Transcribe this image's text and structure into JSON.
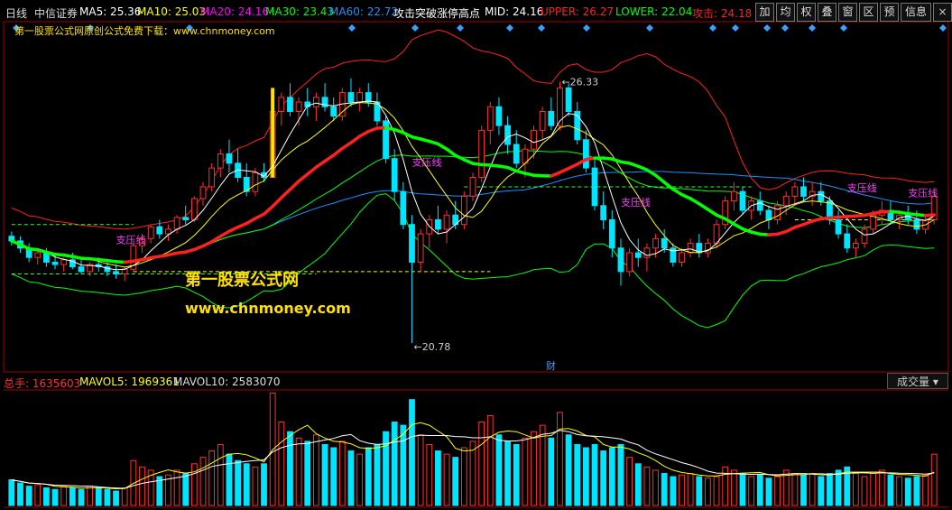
{
  "header": {
    "period": "日线",
    "stock": "中信证券",
    "indicators": [
      {
        "label": "MA5: 25.36",
        "color": "#ffffff"
      },
      {
        "label": "MA10: 25.03",
        "color": "#ffff00"
      },
      {
        "label": "MA20: 24.16",
        "color": "#ff00ff"
      },
      {
        "label": "MA30: 23.43",
        "color": "#00ff00"
      },
      {
        "label": "MA60: 22.72",
        "color": "#1e90ff"
      },
      {
        "label": "攻击突破涨停高点",
        "color": "#ffffff"
      },
      {
        "label": "MID: 24.16",
        "color": "#ffffff"
      },
      {
        "label": "UPPER: 26.27",
        "color": "#ff2020"
      },
      {
        "label": "LOWER: 22.04",
        "color": "#00ff00"
      },
      {
        "label": "攻击: 24.18",
        "color": "#ff2020"
      }
    ],
    "toolbar": [
      "加",
      "均",
      "权",
      "叠",
      "窗",
      "区",
      "预",
      "信息",
      "×"
    ]
  },
  "promo_text": "第一股票公式网原创公式免费下载：www.chnmoney.com",
  "watermark": {
    "title": "第一股票公式网",
    "url": "www.chnmoney.com"
  },
  "annotations": {
    "high": "←26.33",
    "low": "←20.78",
    "fin_mark": "财",
    "support": [
      "支压线",
      "支压线",
      "支压线",
      "支压线",
      "支压线",
      "支压线"
    ]
  },
  "volume_header": {
    "total": "总手: 1635603",
    "mavol5": "MAVOL5: 1969361",
    "mavol10": "MAVOL10: 2583070",
    "dropdown": "成交量"
  },
  "chart_data": {
    "type": "candlestick",
    "price_range": [
      20.4,
      27.3
    ],
    "marked_high": 26.33,
    "marked_low": 20.78,
    "series_colors": {
      "up": "#ff3030",
      "down": "#00e5ff",
      "MA5": "#ffffff",
      "MA10": "#ffff00",
      "MA30": "#00ff00",
      "MA60": "#1e90ff",
      "UPPER": "#ff2020",
      "LOWER": "#00ff00",
      "MID_bull": "#ff2020",
      "MID_bear": "#00ff00"
    },
    "ohlc": [
      [
        23.05,
        23.15,
        22.85,
        22.95
      ],
      [
        22.95,
        23.05,
        22.7,
        22.8
      ],
      [
        22.8,
        22.9,
        22.5,
        22.6
      ],
      [
        22.6,
        22.75,
        22.45,
        22.7
      ],
      [
        22.7,
        22.8,
        22.4,
        22.5
      ],
      [
        22.5,
        22.65,
        22.35,
        22.45
      ],
      [
        22.45,
        22.6,
        22.3,
        22.55
      ],
      [
        22.55,
        22.7,
        22.35,
        22.4
      ],
      [
        22.4,
        22.55,
        22.25,
        22.3
      ],
      [
        22.3,
        22.5,
        22.2,
        22.45
      ],
      [
        22.45,
        22.6,
        22.3,
        22.4
      ],
      [
        22.4,
        22.5,
        22.2,
        22.3
      ],
      [
        22.3,
        22.45,
        22.15,
        22.25
      ],
      [
        22.25,
        22.4,
        22.1,
        22.35
      ],
      [
        22.35,
        22.9,
        22.3,
        22.85
      ],
      [
        22.85,
        23.1,
        22.7,
        23.0
      ],
      [
        23.0,
        23.3,
        22.9,
        23.25
      ],
      [
        23.25,
        23.4,
        23.0,
        23.1
      ],
      [
        23.1,
        23.3,
        22.95,
        23.2
      ],
      [
        23.2,
        23.5,
        23.1,
        23.45
      ],
      [
        23.45,
        23.7,
        23.3,
        23.4
      ],
      [
        23.4,
        23.9,
        23.35,
        23.85
      ],
      [
        23.85,
        24.2,
        23.7,
        24.1
      ],
      [
        24.1,
        24.6,
        24.0,
        24.5
      ],
      [
        24.5,
        24.9,
        24.3,
        24.8
      ],
      [
        24.8,
        25.1,
        24.4,
        24.6
      ],
      [
        24.6,
        24.9,
        24.2,
        24.3
      ],
      [
        24.3,
        24.6,
        23.9,
        24.0
      ],
      [
        24.0,
        24.5,
        23.9,
        24.4
      ],
      [
        24.4,
        24.6,
        24.2,
        24.3
      ],
      [
        24.3,
        25.8,
        24.3,
        25.7
      ],
      [
        25.7,
        26.1,
        25.4,
        26.0
      ],
      [
        26.0,
        26.3,
        25.6,
        25.7
      ],
      [
        25.7,
        26.0,
        25.4,
        25.9
      ],
      [
        25.9,
        26.2,
        25.6,
        25.8
      ],
      [
        25.8,
        26.1,
        25.5,
        26.0
      ],
      [
        26.0,
        26.3,
        25.7,
        25.8
      ],
      [
        25.8,
        26.0,
        25.5,
        25.6
      ],
      [
        25.6,
        26.2,
        25.5,
        26.1
      ],
      [
        26.1,
        26.4,
        25.8,
        25.9
      ],
      [
        25.9,
        26.2,
        25.7,
        26.1
      ],
      [
        26.1,
        26.3,
        25.8,
        25.9
      ],
      [
        25.9,
        26.1,
        25.4,
        25.5
      ],
      [
        25.5,
        25.6,
        24.6,
        24.7
      ],
      [
        24.7,
        24.9,
        23.8,
        24.0
      ],
      [
        24.0,
        24.2,
        23.2,
        23.3
      ],
      [
        23.3,
        23.5,
        20.78,
        22.5
      ],
      [
        22.5,
        23.2,
        22.3,
        23.1
      ],
      [
        23.1,
        23.5,
        22.8,
        23.4
      ],
      [
        23.4,
        23.7,
        23.1,
        23.2
      ],
      [
        23.2,
        23.6,
        22.9,
        23.5
      ],
      [
        23.5,
        23.8,
        23.2,
        23.3
      ],
      [
        23.3,
        24.0,
        23.2,
        23.9
      ],
      [
        23.9,
        24.4,
        23.8,
        24.3
      ],
      [
        24.3,
        25.4,
        24.2,
        25.3
      ],
      [
        25.3,
        25.9,
        25.0,
        25.8
      ],
      [
        25.8,
        26.0,
        25.2,
        25.4
      ],
      [
        25.4,
        25.6,
        24.8,
        25.0
      ],
      [
        25.0,
        25.3,
        24.5,
        24.6
      ],
      [
        24.6,
        25.0,
        24.3,
        24.9
      ],
      [
        24.9,
        25.4,
        24.7,
        25.3
      ],
      [
        25.3,
        25.8,
        25.1,
        25.7
      ],
      [
        25.7,
        26.0,
        25.3,
        25.4
      ],
      [
        25.4,
        26.33,
        25.3,
        26.2
      ],
      [
        26.2,
        26.3,
        25.6,
        25.7
      ],
      [
        25.7,
        25.9,
        25.0,
        25.1
      ],
      [
        25.1,
        25.3,
        24.4,
        24.5
      ],
      [
        24.5,
        24.7,
        23.6,
        23.7
      ],
      [
        23.7,
        24.0,
        23.2,
        23.4
      ],
      [
        23.4,
        23.6,
        22.6,
        22.8
      ],
      [
        22.8,
        23.0,
        22.0,
        22.3
      ],
      [
        22.3,
        22.8,
        22.2,
        22.7
      ],
      [
        22.7,
        23.0,
        22.4,
        22.6
      ],
      [
        22.6,
        22.9,
        22.3,
        22.8
      ],
      [
        22.8,
        23.1,
        22.6,
        23.0
      ],
      [
        23.0,
        23.2,
        22.7,
        22.8
      ],
      [
        22.8,
        22.9,
        22.4,
        22.5
      ],
      [
        22.5,
        22.8,
        22.4,
        22.7
      ],
      [
        22.7,
        23.0,
        22.6,
        22.9
      ],
      [
        22.9,
        23.1,
        22.6,
        22.7
      ],
      [
        22.7,
        23.0,
        22.6,
        22.9
      ],
      [
        22.9,
        23.4,
        22.8,
        23.3
      ],
      [
        23.3,
        23.9,
        23.2,
        23.8
      ],
      [
        23.8,
        24.2,
        23.6,
        24.0
      ],
      [
        24.0,
        24.1,
        23.5,
        23.6
      ],
      [
        23.6,
        23.9,
        23.4,
        23.8
      ],
      [
        23.8,
        24.0,
        23.5,
        23.6
      ],
      [
        23.6,
        23.7,
        23.2,
        23.4
      ],
      [
        23.4,
        23.8,
        23.3,
        23.7
      ],
      [
        23.7,
        24.0,
        23.5,
        23.9
      ],
      [
        23.9,
        24.2,
        23.7,
        24.1
      ],
      [
        24.1,
        24.3,
        23.8,
        23.9
      ],
      [
        23.9,
        24.2,
        23.7,
        24.0
      ],
      [
        24.0,
        24.2,
        23.7,
        23.8
      ],
      [
        23.8,
        23.9,
        23.3,
        23.4
      ],
      [
        23.4,
        23.6,
        23.0,
        23.1
      ],
      [
        23.1,
        23.3,
        22.7,
        22.8
      ],
      [
        22.8,
        23.0,
        22.6,
        22.9
      ],
      [
        22.9,
        23.3,
        22.8,
        23.2
      ],
      [
        23.2,
        23.6,
        23.1,
        23.5
      ],
      [
        23.5,
        23.8,
        23.3,
        23.6
      ],
      [
        23.6,
        23.8,
        23.3,
        23.4
      ],
      [
        23.4,
        23.6,
        23.2,
        23.5
      ],
      [
        23.5,
        23.7,
        23.3,
        23.4
      ],
      [
        23.4,
        23.6,
        23.1,
        23.2
      ],
      [
        23.2,
        23.5,
        23.1,
        23.4
      ],
      [
        23.4,
        24.0,
        23.3,
        23.9
      ]
    ],
    "volume": [
      0.8,
      0.7,
      0.6,
      0.65,
      0.55,
      0.5,
      0.6,
      0.55,
      0.5,
      0.6,
      0.55,
      0.5,
      0.45,
      0.55,
      1.4,
      1.2,
      1.1,
      0.9,
      0.95,
      1.1,
      1.0,
      1.3,
      1.5,
      1.7,
      1.9,
      1.6,
      1.4,
      1.3,
      1.2,
      1.3,
      3.5,
      2.6,
      2.3,
      2.1,
      2.0,
      2.2,
      1.9,
      1.8,
      2.0,
      1.7,
      1.6,
      1.8,
      1.9,
      2.3,
      2.6,
      2.5,
      3.3,
      2.2,
      1.9,
      1.7,
      1.6,
      1.5,
      1.8,
      2.0,
      2.6,
      2.8,
      2.2,
      2.0,
      1.9,
      2.1,
      2.3,
      2.5,
      2.1,
      2.9,
      2.2,
      1.9,
      1.8,
      1.9,
      1.7,
      1.8,
      1.9,
      1.5,
      1.3,
      1.2,
      1.1,
      1.0,
      0.9,
      0.95,
      1.0,
      0.9,
      0.85,
      0.9,
      1.2,
      1.1,
      1.0,
      0.9,
      0.95,
      0.85,
      0.9,
      1.1,
      1.0,
      0.95,
      1.0,
      0.9,
      1.0,
      1.1,
      1.2,
      1.0,
      0.9,
      1.0,
      1.1,
      0.95,
      0.9,
      0.85,
      0.9,
      0.95,
      1.6
    ]
  }
}
